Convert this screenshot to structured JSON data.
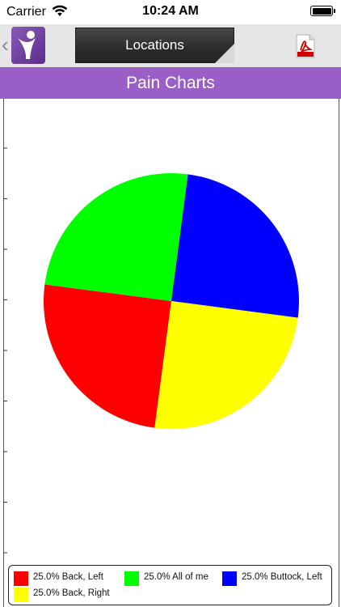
{
  "status_bar": {
    "carrier": "Carrier",
    "time": "10:24 AM"
  },
  "nav": {
    "back_icon": "chevron-left-icon",
    "logo_icon": "person-logo-icon",
    "tab_label": "Locations",
    "pdf_icon": "pdf-icon"
  },
  "header": {
    "title": "Pain Charts",
    "color": "#9a5fc7"
  },
  "chart_data": {
    "type": "pie",
    "title": "",
    "slices": [
      {
        "label": "Back, Left",
        "percent": 25.0,
        "value": 25,
        "color": "#ff0000"
      },
      {
        "label": "All of me",
        "percent": 25.0,
        "value": 25,
        "color": "#00ff00"
      },
      {
        "label": "Buttock, Left",
        "percent": 25.0,
        "value": 25,
        "color": "#0000ff"
      },
      {
        "label": "Back, Right",
        "percent": 25.0,
        "value": 25,
        "color": "#ffff00"
      }
    ],
    "legend_entries": [
      "25.0% Back, Left",
      "25.0% All of me",
      "25.0% Buttock, Left",
      "25.0% Back, Right"
    ],
    "legend_placement": "bottom"
  }
}
